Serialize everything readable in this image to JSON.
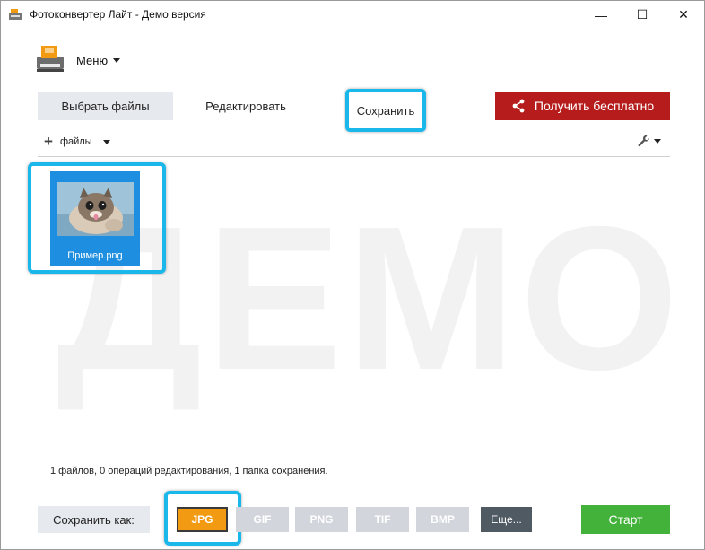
{
  "window": {
    "title": "Фотоконвертер Лайт - Демо версия",
    "minimize_glyph": "—",
    "maximize_glyph": "☐",
    "close_glyph": "✕"
  },
  "menu": {
    "label": "Меню"
  },
  "tabs": {
    "select_files": "Выбрать файлы",
    "edit": "Редактировать",
    "save": "Сохранить"
  },
  "cta": {
    "label": "Получить бесплатно",
    "icon": "share-icon",
    "color": "#b61c1c"
  },
  "toolbar": {
    "files_label": "файлы",
    "settings_icon": "wrench-icon"
  },
  "watermark": "ДЕМО",
  "files": [
    {
      "name": "Пример.png",
      "thumbnail": "kitten-photo"
    }
  ],
  "status": "1 файлов, 0 операций редактирования, 1 папка сохранения.",
  "bottom": {
    "save_as_label": "Сохранить как:",
    "formats": [
      "JPG",
      "GIF",
      "PNG",
      "TIF",
      "BMP"
    ],
    "selected_format": "JPG",
    "more_label": "Еще...",
    "start_label": "Старт"
  },
  "colors": {
    "highlight": "#1ab8ea",
    "selected_format": "#f29a12",
    "start": "#43b23a",
    "tile": "#1e8ee0"
  }
}
